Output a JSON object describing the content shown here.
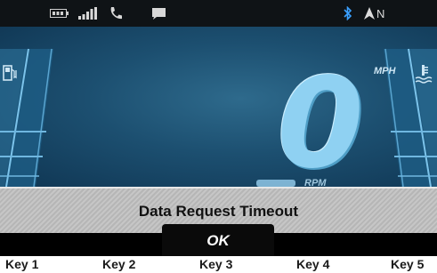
{
  "status_bar": {
    "icons": [
      "battery-icon",
      "signal-icon",
      "phone-icon",
      "message-icon",
      "bluetooth-icon",
      "navigation-arrow-icon"
    ],
    "heading": "N"
  },
  "dashboard": {
    "speed_value": "0",
    "speed_unit": "MPH",
    "rpm_label": "RPM",
    "left_gauge_icon": "fuel-pump-icon",
    "right_gauge_icon": "coolant-temperature-icon"
  },
  "dialog": {
    "message": "Data Request Timeout"
  },
  "buttons": {
    "ok_label": "OK"
  },
  "keys": [
    "Key 1",
    "Key 2",
    "Key 3",
    "Key 4",
    "Key 5"
  ],
  "colors": {
    "status_bar_bg": "#0f1316",
    "dashboard_bg": "#1c4f70",
    "speed_digit": "#8fd1f2",
    "bluetooth": "#3aa0ff",
    "dialog_bg": "#c0c0c0"
  }
}
